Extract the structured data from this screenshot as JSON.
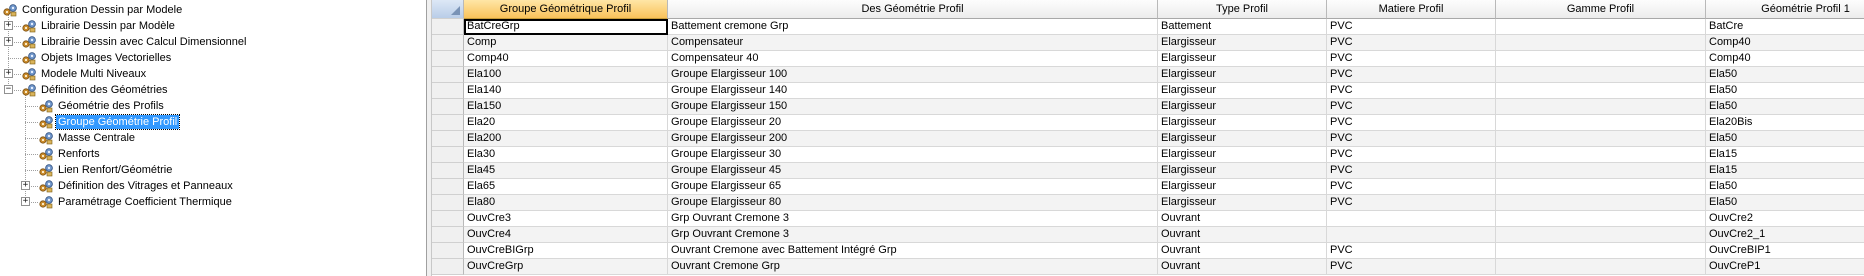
{
  "tree": {
    "nodes": [
      {
        "label": "Configuration Dessin par Modele",
        "expander": "",
        "icon": "gear-group-icon"
      },
      {
        "label": "Librairie Dessin par Modèle",
        "expander": "+",
        "icon": "gear-group-icon"
      },
      {
        "label": "Librairie Dessin avec Calcul Dimensionnel",
        "expander": "+",
        "icon": "gear-group-icon"
      },
      {
        "label": "Objets Images Vectorielles",
        "expander": "",
        "icon": "gear-group-icon"
      },
      {
        "label": "Modele Multi Niveaux",
        "expander": "+",
        "icon": "gear-group-icon"
      },
      {
        "label": "Définition des Géométries",
        "expander": "−",
        "icon": "gear-group-icon"
      },
      {
        "label": "Géométrie des Profils",
        "expander": "",
        "icon": "gear-group-icon"
      },
      {
        "label": "Groupe Géométrie Profil",
        "expander": "",
        "icon": "gear-group-icon",
        "selected": true
      },
      {
        "label": "Masse Centrale",
        "expander": "",
        "icon": "gear-group-icon"
      },
      {
        "label": "Renforts",
        "expander": "",
        "icon": "gear-group-icon"
      },
      {
        "label": "Lien Renfort/Géométrie",
        "expander": "",
        "icon": "gear-group-icon"
      },
      {
        "label": "Définition des Vitrages et Panneaux",
        "expander": "+",
        "icon": "gear-group-icon"
      },
      {
        "label": "Paramétrage Coefficient Thermique",
        "expander": "+",
        "icon": "gear-group-icon"
      }
    ]
  },
  "grid": {
    "columns": [
      "Groupe Géométrique Profil",
      "Des Géométrie Profil",
      "Type Profil",
      "Matiere Profil",
      "Gamme Profil",
      "Géométrie Profil 1"
    ],
    "rows": [
      [
        "BatCreGrp",
        "Battement cremone Grp",
        "Battement",
        "PVC",
        "",
        "BatCre"
      ],
      [
        "Comp",
        "Compensateur",
        "Elargisseur",
        "PVC",
        "",
        "Comp40"
      ],
      [
        "Comp40",
        "Compensateur 40",
        "Elargisseur",
        "PVC",
        "",
        "Comp40"
      ],
      [
        "Ela100",
        "Groupe Elargisseur 100",
        "Elargisseur",
        "PVC",
        "",
        "Ela50"
      ],
      [
        "Ela140",
        "Groupe Elargisseur 140",
        "Elargisseur",
        "PVC",
        "",
        "Ela50"
      ],
      [
        "Ela150",
        "Groupe Elargisseur 150",
        "Elargisseur",
        "PVC",
        "",
        "Ela50"
      ],
      [
        "Ela20",
        "Groupe Elargisseur 20",
        "Elargisseur",
        "PVC",
        "",
        "Ela20Bis"
      ],
      [
        "Ela200",
        "Groupe Elargisseur 200",
        "Elargisseur",
        "PVC",
        "",
        "Ela50"
      ],
      [
        "Ela30",
        "Groupe Elargisseur 30",
        "Elargisseur",
        "PVC",
        "",
        "Ela15"
      ],
      [
        "Ela45",
        "Groupe Elargisseur 45",
        "Elargisseur",
        "PVC",
        "",
        "Ela15"
      ],
      [
        "Ela65",
        "Groupe Elargisseur 65",
        "Elargisseur",
        "PVC",
        "",
        "Ela50"
      ],
      [
        "Ela80",
        "Groupe Elargisseur 80",
        "Elargisseur",
        "PVC",
        "",
        "Ela50"
      ],
      [
        "OuvCre3",
        "Grp Ouvrant Cremone 3",
        "Ouvrant",
        "",
        "",
        "OuvCre2"
      ],
      [
        "OuvCre4",
        "Grp Ouvrant Cremone 3",
        "Ouvrant",
        "",
        "",
        "OuvCre2_1"
      ],
      [
        "OuvCreBIGrp",
        "Ouvrant Cremone avec Battement Intégré Grp",
        "Ouvrant",
        "PVC",
        "",
        "OuvCreBIP1"
      ],
      [
        "OuvCreGrp",
        "Ouvrant Cremone Grp",
        "Ouvrant",
        "PVC",
        "",
        "OuvCreP1"
      ]
    ]
  },
  "colors": {
    "selection": "#3399ff",
    "active_header": "#f9c25b"
  }
}
